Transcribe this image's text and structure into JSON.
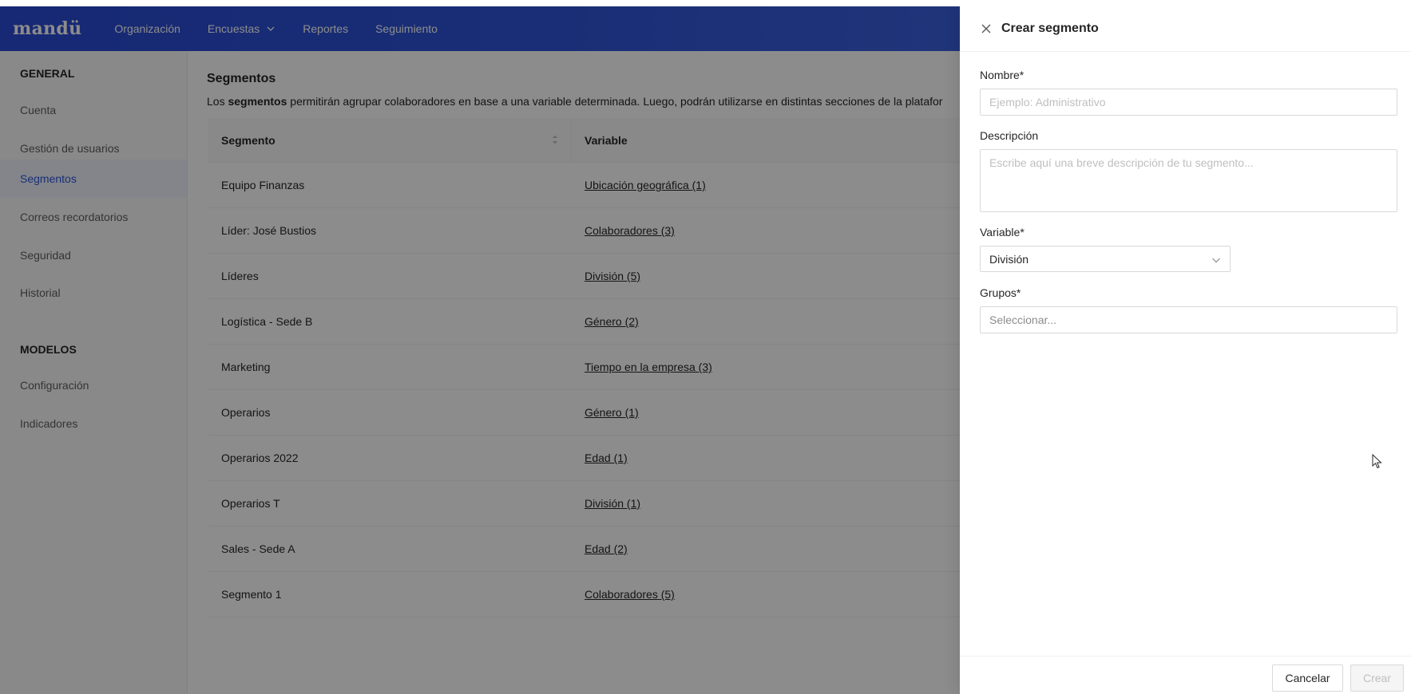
{
  "topnav": {
    "logo": "mandü",
    "items": [
      {
        "label": "Organización"
      },
      {
        "label": "Encuestas"
      },
      {
        "label": "Reportes"
      },
      {
        "label": "Seguimiento"
      }
    ]
  },
  "sidebar": {
    "general_title": "GENERAL",
    "general_items": [
      {
        "label": "Cuenta"
      },
      {
        "label": "Gestión de usuarios"
      },
      {
        "label": "Segmentos",
        "active": true
      },
      {
        "label": "Correos recordatorios"
      },
      {
        "label": "Seguridad"
      },
      {
        "label": "Historial"
      }
    ],
    "models_title": "MODELOS",
    "models_items": [
      {
        "label": "Configuración"
      },
      {
        "label": "Indicadores"
      }
    ]
  },
  "main": {
    "title": "Segmentos",
    "desc_prefix": "Los ",
    "desc_bold": "segmentos",
    "desc_suffix": " permitirán agrupar colaboradores en base a una variable determinada. Luego, podrán utilizarse en distintas secciones de la platafor",
    "columns": {
      "segment": "Segmento",
      "variable": "Variable"
    },
    "rows": [
      {
        "segment": "Equipo Finanzas",
        "variable": "Ubicación geográfica (1)"
      },
      {
        "segment": "Líder: José Bustios",
        "variable": "Colaboradores (3)"
      },
      {
        "segment": "Líderes",
        "variable": "División (5)"
      },
      {
        "segment": "Logística - Sede B",
        "variable": "Género (2)"
      },
      {
        "segment": "Marketing",
        "variable": "Tiempo en la empresa (3)"
      },
      {
        "segment": "Operarios",
        "variable": "Género (1)"
      },
      {
        "segment": "Operarios 2022",
        "variable": "Edad (1)"
      },
      {
        "segment": "Operarios T",
        "variable": "División (1)"
      },
      {
        "segment": "Sales - Sede A",
        "variable": "Edad (2)"
      },
      {
        "segment": "Segmento 1",
        "variable": "Colaboradores (5)"
      }
    ]
  },
  "drawer": {
    "title": "Crear segmento",
    "name_label": "Nombre*",
    "name_placeholder": "Ejemplo: Administrativo",
    "desc_label": "Descripción",
    "desc_placeholder": "Escribe aquí una breve descripción de tu segmento...",
    "variable_label": "Variable*",
    "variable_value": "División",
    "groups_label": "Grupos*",
    "groups_placeholder": "Seleccionar...",
    "cancel_label": "Cancelar",
    "create_label": "Crear"
  },
  "colors": {
    "brand": "#2f55d8",
    "active_bg": "#eef2fe"
  }
}
